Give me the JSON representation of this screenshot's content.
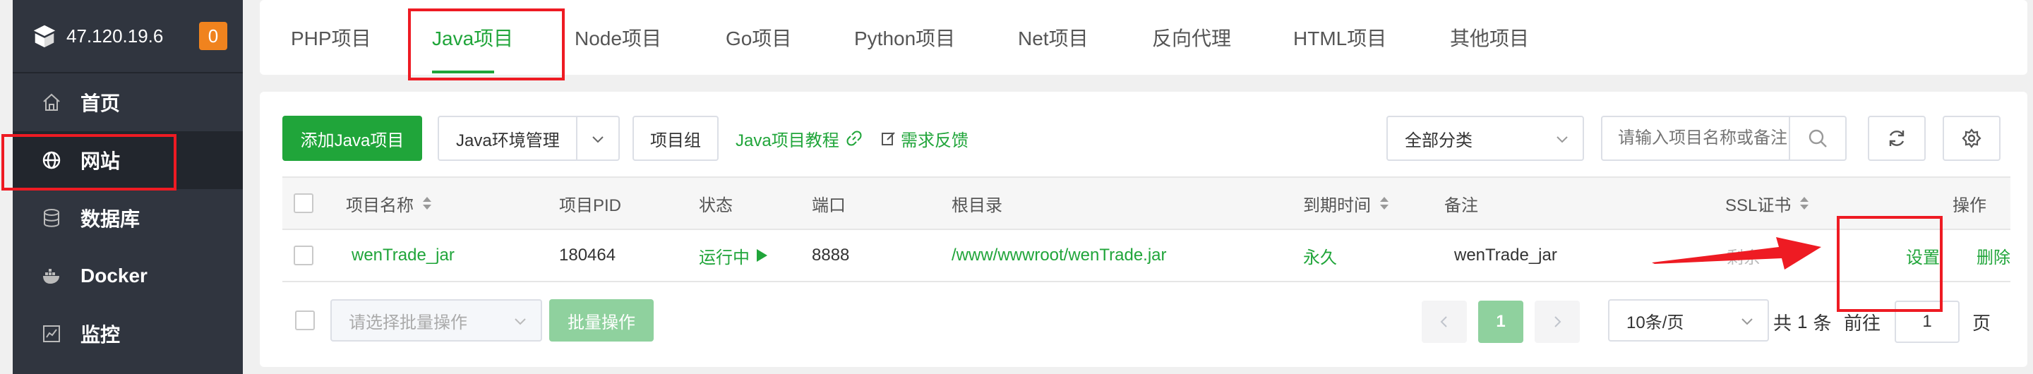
{
  "sidebar": {
    "server_ip": "47.120.19.6",
    "notification_count": "0",
    "items": [
      {
        "label": "首页",
        "icon": "home-icon"
      },
      {
        "label": "网站",
        "icon": "globe-icon"
      },
      {
        "label": "数据库",
        "icon": "database-icon"
      },
      {
        "label": "Docker",
        "icon": "docker-icon"
      },
      {
        "label": "监控",
        "icon": "monitor-icon"
      }
    ]
  },
  "tabs": [
    "PHP项目",
    "Java项目",
    "Node项目",
    "Go项目",
    "Python项目",
    "Net项目",
    "反向代理",
    "HTML项目",
    "其他项目"
  ],
  "active_tab": "Java项目",
  "toolbar": {
    "add_button": "添加Java项目",
    "env_manage": "Java环境管理",
    "project_group": "项目组",
    "tutorial_link": "Java项目教程",
    "feedback_link": "需求反馈",
    "category_select": "全部分类",
    "search_placeholder": "请输入项目名称或备注"
  },
  "table": {
    "headers": {
      "name": "项目名称",
      "pid": "项目PID",
      "status": "状态",
      "port": "端口",
      "root": "根目录",
      "expire": "到期时间",
      "remark": "备注",
      "ssl": "SSL证书",
      "action": "操作"
    },
    "rows": [
      {
        "name": "wenTrade_jar",
        "pid": "180464",
        "status": "运行中",
        "port": "8888",
        "root": "/www/wwwroot/wenTrade.jar",
        "expire": "永久",
        "remark": "wenTrade_jar",
        "ssl": "剩余",
        "action_settings": "设置",
        "action_delete": "删除"
      }
    ]
  },
  "footer": {
    "batch_placeholder": "请选择批量操作",
    "batch_button": "批量操作",
    "current_page": "1",
    "page_size": "10条/页",
    "total_prefix": "共",
    "total_count": "1",
    "total_suffix": "条",
    "goto_label": "前往",
    "goto_value": "1",
    "page_suffix": "页"
  },
  "colors": {
    "brand_green": "#20a53a",
    "sidebar_bg": "#30353f",
    "badge_orange": "#f0831e",
    "annotation_red": "#ee1b23"
  }
}
